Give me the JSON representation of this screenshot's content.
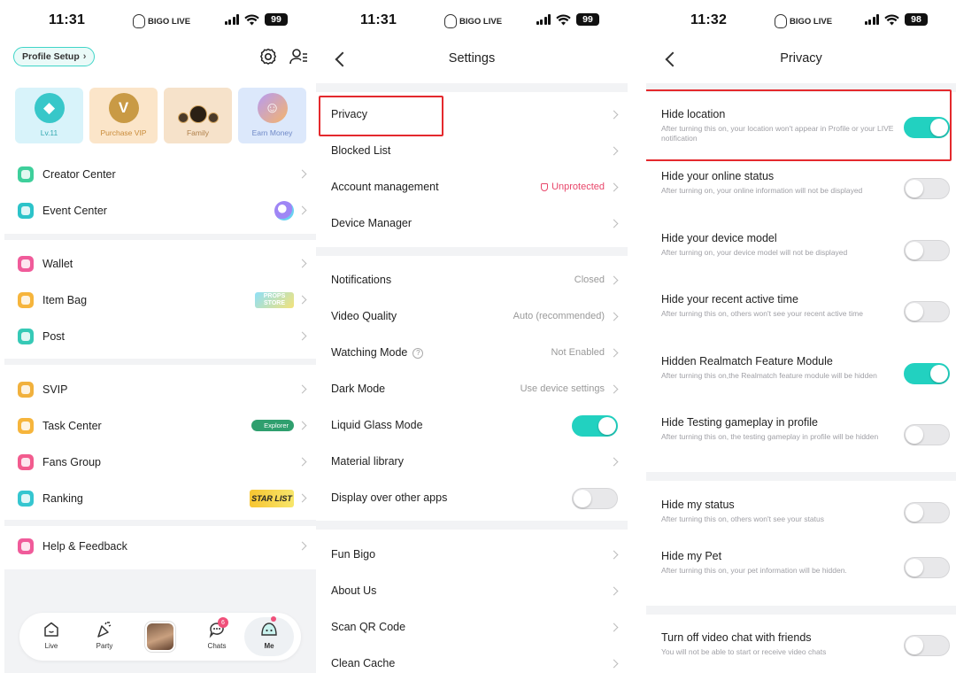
{
  "screen_me": {
    "status": {
      "time": "11:31",
      "brand": "BIGO LIVE",
      "battery": "99"
    },
    "profile_setup": "Profile Setup",
    "cards": [
      {
        "label": "Lv.11",
        "glyph": "◆"
      },
      {
        "label": "Purchase VIP",
        "glyph": "V"
      },
      {
        "label": "Family",
        "glyph": ""
      },
      {
        "label": "Earn Money",
        "glyph": "☺"
      }
    ],
    "menu_group1": [
      {
        "label": "Creator Center",
        "color": "#3ecf9b"
      },
      {
        "label": "Event Center",
        "color": "#2cc3c9"
      }
    ],
    "menu_group2": [
      {
        "label": "Wallet",
        "color": "#f05b9a"
      },
      {
        "label": "Item Bag",
        "color": "#f6b53c",
        "tag": "PROPS STORE"
      },
      {
        "label": "Post",
        "color": "#36c9b6"
      }
    ],
    "menu_group3": [
      {
        "label": "SVIP",
        "color": "#f1b13d"
      },
      {
        "label": "Task Center",
        "color": "#f6b53c",
        "tag": "Explorer"
      },
      {
        "label": "Fans Group",
        "color": "#f25b8e"
      },
      {
        "label": "Ranking",
        "color": "#35c6d0",
        "tag": "STAR LIST"
      }
    ],
    "menu_group4": [
      {
        "label": "Help & Feedback",
        "color": "#f05b9a"
      }
    ],
    "tabs": [
      {
        "label": "Live"
      },
      {
        "label": "Party"
      },
      {
        "label": "Chats",
        "badge": "6"
      },
      {
        "label": "Me"
      }
    ]
  },
  "screen_settings": {
    "status": {
      "time": "11:31",
      "brand": "BIGO LIVE",
      "battery": "99"
    },
    "title": "Settings",
    "group1": [
      {
        "label": "Privacy",
        "value": ""
      },
      {
        "label": "Blocked List",
        "value": ""
      },
      {
        "label": "Account management",
        "value": "Unprotected"
      },
      {
        "label": "Device Manager",
        "value": ""
      }
    ],
    "group2": [
      {
        "label": "Notifications",
        "value": "Closed"
      },
      {
        "label": "Video Quality",
        "value": "Auto (recommended)"
      },
      {
        "label": "Watching Mode",
        "value": "Not Enabled"
      },
      {
        "label": "Dark Mode",
        "value": "Use device settings"
      },
      {
        "label": "Liquid Glass Mode",
        "toggle": true
      },
      {
        "label": "Material library",
        "value": ""
      },
      {
        "label": "Display over other apps",
        "toggle": false
      }
    ],
    "group3": [
      {
        "label": "Fun Bigo"
      },
      {
        "label": "About Us"
      },
      {
        "label": "Scan QR Code"
      },
      {
        "label": "Clean Cache"
      }
    ]
  },
  "screen_privacy": {
    "status": {
      "time": "11:32",
      "brand": "BIGO LIVE",
      "battery": "98"
    },
    "title": "Privacy",
    "items": [
      {
        "title": "Hide location",
        "desc": "After turning this on, your location won't appear in Profile or your LIVE notification",
        "on": true
      },
      {
        "title": "Hide your online status",
        "desc": "After turning on, your online information will not be displayed",
        "on": false
      },
      {
        "title": "Hide your device model",
        "desc": "After turning on, your device model will not be displayed",
        "on": false
      },
      {
        "title": "Hide your recent active time",
        "desc": "After turning this on, others won't see your recent active time",
        "on": false
      },
      {
        "title": "Hidden Realmatch Feature Module",
        "desc": "After turning this on,the Realmatch feature module will be hidden",
        "on": true
      },
      {
        "title": "Hide Testing gameplay in profile",
        "desc": "After turning this on, the testing gameplay in profile will be hidden",
        "on": false
      },
      {
        "title": "Hide my status",
        "desc": "After turning this on, others won't see your status",
        "on": false
      },
      {
        "title": "Hide my Pet",
        "desc": "After turning this on, your pet information will be hidden.",
        "on": false
      },
      {
        "title": "Turn off video chat with friends",
        "desc": "You will not be able to start or receive video chats",
        "on": false
      }
    ]
  },
  "colors": {
    "accent": "#22d1c0",
    "highlight_box": "#e4292d",
    "warning": "#e8466a"
  }
}
